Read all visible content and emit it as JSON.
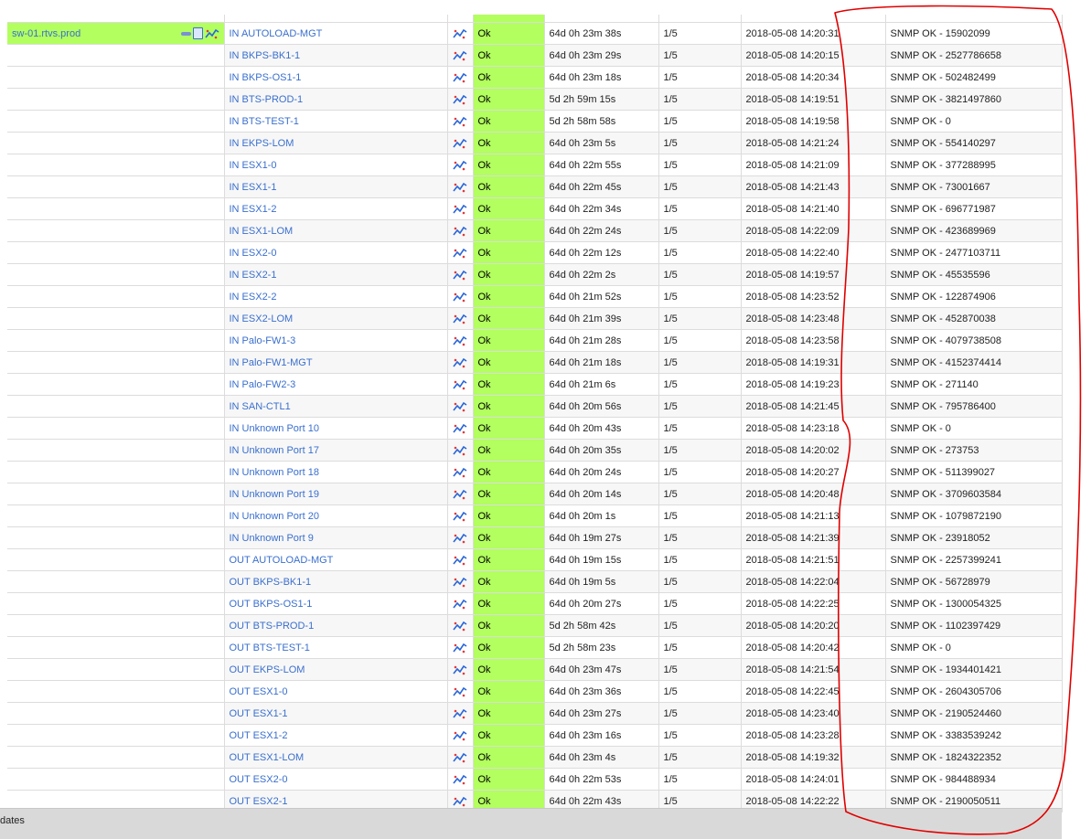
{
  "host": {
    "name": "sw-01.rtvs.prod",
    "icons": [
      "notes-icon",
      "document-icon",
      "graph-icon"
    ]
  },
  "status_color": "#b2ff5f",
  "link_color": "#3a6fce",
  "annotation_color": "#e00000",
  "bottom_bar": {
    "label": "dates"
  },
  "rows": [
    {
      "service": "IN AUTOLOAD-MGT",
      "status": "Ok",
      "duration": "64d 0h 23m 38s",
      "attempt": "1/5",
      "last_check": "2018-05-08 14:20:31",
      "info": "SNMP OK - 15902099"
    },
    {
      "service": "IN BKPS-BK1-1",
      "status": "Ok",
      "duration": "64d 0h 23m 29s",
      "attempt": "1/5",
      "last_check": "2018-05-08 14:20:15",
      "info": "SNMP OK - 2527786658"
    },
    {
      "service": "IN BKPS-OS1-1",
      "status": "Ok",
      "duration": "64d 0h 23m 18s",
      "attempt": "1/5",
      "last_check": "2018-05-08 14:20:34",
      "info": "SNMP OK - 502482499"
    },
    {
      "service": "IN BTS-PROD-1",
      "status": "Ok",
      "duration": "5d 2h 59m 15s",
      "attempt": "1/5",
      "last_check": "2018-05-08 14:19:51",
      "info": "SNMP OK - 3821497860"
    },
    {
      "service": "IN BTS-TEST-1",
      "status": "Ok",
      "duration": "5d 2h 58m 58s",
      "attempt": "1/5",
      "last_check": "2018-05-08 14:19:58",
      "info": "SNMP OK - 0"
    },
    {
      "service": "IN EKPS-LOM",
      "status": "Ok",
      "duration": "64d 0h 23m 5s",
      "attempt": "1/5",
      "last_check": "2018-05-08 14:21:24",
      "info": "SNMP OK - 554140297"
    },
    {
      "service": "IN ESX1-0",
      "status": "Ok",
      "duration": "64d 0h 22m 55s",
      "attempt": "1/5",
      "last_check": "2018-05-08 14:21:09",
      "info": "SNMP OK - 377288995"
    },
    {
      "service": "IN ESX1-1",
      "status": "Ok",
      "duration": "64d 0h 22m 45s",
      "attempt": "1/5",
      "last_check": "2018-05-08 14:21:43",
      "info": "SNMP OK - 73001667"
    },
    {
      "service": "IN ESX1-2",
      "status": "Ok",
      "duration": "64d 0h 22m 34s",
      "attempt": "1/5",
      "last_check": "2018-05-08 14:21:40",
      "info": "SNMP OK - 696771987"
    },
    {
      "service": "IN ESX1-LOM",
      "status": "Ok",
      "duration": "64d 0h 22m 24s",
      "attempt": "1/5",
      "last_check": "2018-05-08 14:22:09",
      "info": "SNMP OK - 423689969"
    },
    {
      "service": "IN ESX2-0",
      "status": "Ok",
      "duration": "64d 0h 22m 12s",
      "attempt": "1/5",
      "last_check": "2018-05-08 14:22:40",
      "info": "SNMP OK - 2477103711"
    },
    {
      "service": "IN ESX2-1",
      "status": "Ok",
      "duration": "64d 0h 22m 2s",
      "attempt": "1/5",
      "last_check": "2018-05-08 14:19:57",
      "info": "SNMP OK - 45535596"
    },
    {
      "service": "IN ESX2-2",
      "status": "Ok",
      "duration": "64d 0h 21m 52s",
      "attempt": "1/5",
      "last_check": "2018-05-08 14:23:52",
      "info": "SNMP OK - 122874906"
    },
    {
      "service": "IN ESX2-LOM",
      "status": "Ok",
      "duration": "64d 0h 21m 39s",
      "attempt": "1/5",
      "last_check": "2018-05-08 14:23:48",
      "info": "SNMP OK - 452870038"
    },
    {
      "service": "IN Palo-FW1-3",
      "status": "Ok",
      "duration": "64d 0h 21m 28s",
      "attempt": "1/5",
      "last_check": "2018-05-08 14:23:58",
      "info": "SNMP OK - 4079738508"
    },
    {
      "service": "IN Palo-FW1-MGT",
      "status": "Ok",
      "duration": "64d 0h 21m 18s",
      "attempt": "1/5",
      "last_check": "2018-05-08 14:19:31",
      "info": "SNMP OK - 4152374414"
    },
    {
      "service": "IN Palo-FW2-3",
      "status": "Ok",
      "duration": "64d 0h 21m 6s",
      "attempt": "1/5",
      "last_check": "2018-05-08 14:19:23",
      "info": "SNMP OK - 271140"
    },
    {
      "service": "IN SAN-CTL1",
      "status": "Ok",
      "duration": "64d 0h 20m 56s",
      "attempt": "1/5",
      "last_check": "2018-05-08 14:21:45",
      "info": "SNMP OK - 795786400"
    },
    {
      "service": "IN Unknown Port 10",
      "status": "Ok",
      "duration": "64d 0h 20m 43s",
      "attempt": "1/5",
      "last_check": "2018-05-08 14:23:18",
      "info": "SNMP OK - 0"
    },
    {
      "service": "IN Unknown Port 17",
      "status": "Ok",
      "duration": "64d 0h 20m 35s",
      "attempt": "1/5",
      "last_check": "2018-05-08 14:20:02",
      "info": "SNMP OK - 273753"
    },
    {
      "service": "IN Unknown Port 18",
      "status": "Ok",
      "duration": "64d 0h 20m 24s",
      "attempt": "1/5",
      "last_check": "2018-05-08 14:20:27",
      "info": "SNMP OK - 511399027"
    },
    {
      "service": "IN Unknown Port 19",
      "status": "Ok",
      "duration": "64d 0h 20m 14s",
      "attempt": "1/5",
      "last_check": "2018-05-08 14:20:48",
      "info": "SNMP OK - 3709603584"
    },
    {
      "service": "IN Unknown Port 20",
      "status": "Ok",
      "duration": "64d 0h 20m 1s",
      "attempt": "1/5",
      "last_check": "2018-05-08 14:21:13",
      "info": "SNMP OK - 1079872190"
    },
    {
      "service": "IN Unknown Port 9",
      "status": "Ok",
      "duration": "64d 0h 19m 27s",
      "attempt": "1/5",
      "last_check": "2018-05-08 14:21:39",
      "info": "SNMP OK - 23918052"
    },
    {
      "service": "OUT AUTOLOAD-MGT",
      "status": "Ok",
      "duration": "64d 0h 19m 15s",
      "attempt": "1/5",
      "last_check": "2018-05-08 14:21:51",
      "info": "SNMP OK - 2257399241"
    },
    {
      "service": "OUT BKPS-BK1-1",
      "status": "Ok",
      "duration": "64d 0h 19m 5s",
      "attempt": "1/5",
      "last_check": "2018-05-08 14:22:04",
      "info": "SNMP OK - 56728979"
    },
    {
      "service": "OUT BKPS-OS1-1",
      "status": "Ok",
      "duration": "64d 0h 20m 27s",
      "attempt": "1/5",
      "last_check": "2018-05-08 14:22:25",
      "info": "SNMP OK - 1300054325"
    },
    {
      "service": "OUT BTS-PROD-1",
      "status": "Ok",
      "duration": "5d 2h 58m 42s",
      "attempt": "1/5",
      "last_check": "2018-05-08 14:20:20",
      "info": "SNMP OK - 1102397429"
    },
    {
      "service": "OUT BTS-TEST-1",
      "status": "Ok",
      "duration": "5d 2h 58m 23s",
      "attempt": "1/5",
      "last_check": "2018-05-08 14:20:42",
      "info": "SNMP OK - 0"
    },
    {
      "service": "OUT EKPS-LOM",
      "status": "Ok",
      "duration": "64d 0h 23m 47s",
      "attempt": "1/5",
      "last_check": "2018-05-08 14:21:54",
      "info": "SNMP OK - 1934401421"
    },
    {
      "service": "OUT ESX1-0",
      "status": "Ok",
      "duration": "64d 0h 23m 36s",
      "attempt": "1/5",
      "last_check": "2018-05-08 14:22:45",
      "info": "SNMP OK - 2604305706"
    },
    {
      "service": "OUT ESX1-1",
      "status": "Ok",
      "duration": "64d 0h 23m 27s",
      "attempt": "1/5",
      "last_check": "2018-05-08 14:23:40",
      "info": "SNMP OK - 2190524460"
    },
    {
      "service": "OUT ESX1-2",
      "status": "Ok",
      "duration": "64d 0h 23m 16s",
      "attempt": "1/5",
      "last_check": "2018-05-08 14:23:28",
      "info": "SNMP OK - 3383539242"
    },
    {
      "service": "OUT ESX1-LOM",
      "status": "Ok",
      "duration": "64d 0h 23m 4s",
      "attempt": "1/5",
      "last_check": "2018-05-08 14:19:32",
      "info": "SNMP OK - 1824322352"
    },
    {
      "service": "OUT ESX2-0",
      "status": "Ok",
      "duration": "64d 0h 22m 53s",
      "attempt": "1/5",
      "last_check": "2018-05-08 14:24:01",
      "info": "SNMP OK - 984488934"
    },
    {
      "service": "OUT ESX2-1",
      "status": "Ok",
      "duration": "64d 0h 22m 43s",
      "attempt": "1/5",
      "last_check": "2018-05-08 14:22:22",
      "info": "SNMP OK - 2190050511"
    }
  ]
}
